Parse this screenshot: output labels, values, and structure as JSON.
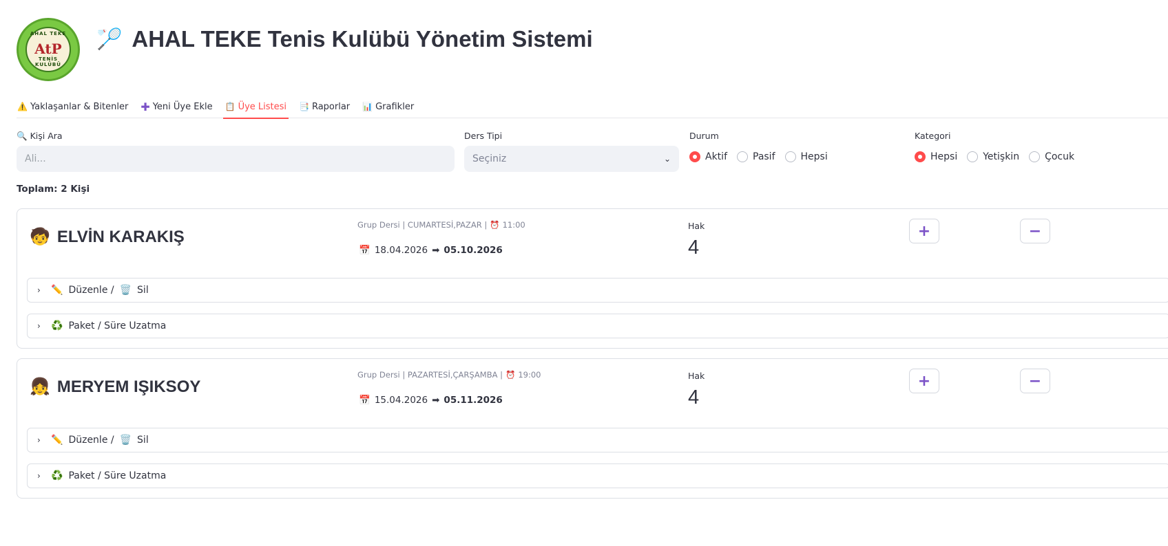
{
  "logo": {
    "top_text": "AHAL TEKE",
    "monogram": "AtP",
    "bottom_text": "TENİS KULÜBÜ"
  },
  "header": {
    "icon": "tennis-racket-icon",
    "title": "AHAL TEKE Tenis Kulübü Yönetim Sistemi"
  },
  "tabs": [
    {
      "icon": "warning-icon",
      "label": "Yaklaşanlar & Bitenler"
    },
    {
      "icon": "plus-icon",
      "label": "Yeni Üye Ekle"
    },
    {
      "icon": "clipboard-icon",
      "label": "Üye Listesi",
      "active": true
    },
    {
      "icon": "report-icon",
      "label": "Raporlar"
    },
    {
      "icon": "chart-icon",
      "label": "Grafikler"
    }
  ],
  "filters": {
    "search_label": "Kişi Ara",
    "search_placeholder": "Ali...",
    "ders_label": "Ders Tipi",
    "ders_value": "Seçiniz",
    "durum_label": "Durum",
    "durum_options": [
      "Aktif",
      "Pasif",
      "Hepsi"
    ],
    "durum_selected": "Aktif",
    "kategori_label": "Kategori",
    "kategori_options": [
      "Hepsi",
      "Yetişkin",
      "Çocuk"
    ],
    "kategori_selected": "Hepsi"
  },
  "total": "Toplam: 2 Kişi",
  "members": [
    {
      "name": "ELVİN KARAKIŞ",
      "info": "Grup Dersi | CUMARTESİ,PAZAR |",
      "time": "11:00",
      "start": "18.04.2026",
      "end": "05.10.2026",
      "hak_label": "Hak",
      "hak": "4",
      "edit_label": "Düzenle / ",
      "delete_label": "Sil",
      "package_label": "Paket / Süre Uzatma"
    },
    {
      "name": "MERYEM IŞIKSOY",
      "info": "Grup Dersi | PAZARTESİ,ÇARŞAMBA |",
      "time": "19:00",
      "start": "15.04.2026",
      "end": "05.11.2026",
      "hak_label": "Hak",
      "hak": "4",
      "edit_label": "Düzenle / ",
      "delete_label": "Sil",
      "package_label": "Paket / Süre Uzatma"
    }
  ],
  "colors": {
    "accent": "#ff4b4b",
    "button_icon": "#7b52c7",
    "input_bg": "#f0f2f6"
  }
}
